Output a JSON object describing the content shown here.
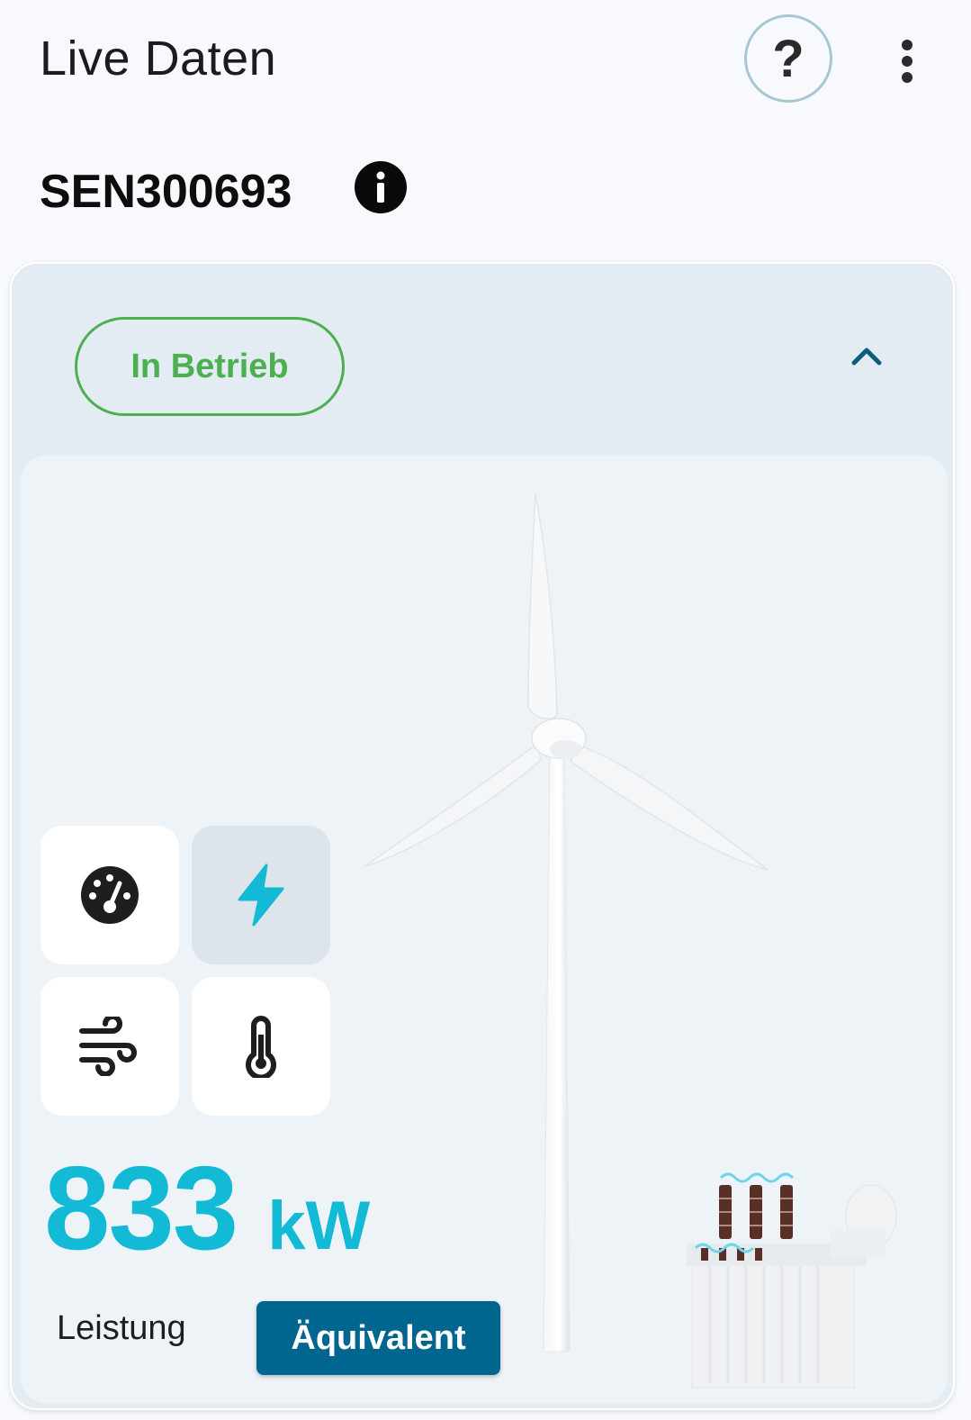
{
  "header": {
    "title": "Live Daten",
    "help_label": "?",
    "help_icon": "question-icon",
    "more_icon": "more-vert-icon"
  },
  "device": {
    "id": "SEN300693",
    "info_icon": "info-icon"
  },
  "status": {
    "label": "In Betrieb",
    "color": "#4caf50"
  },
  "metrics": {
    "tiles": [
      {
        "icon": "speedometer-icon",
        "active": false
      },
      {
        "icon": "lightning-bolt-icon",
        "active": true
      },
      {
        "icon": "wind-icon",
        "active": false
      },
      {
        "icon": "thermometer-icon",
        "active": false
      }
    ],
    "value": "833",
    "unit": "kW",
    "accent": "#12bad6"
  },
  "tabs": {
    "items": [
      "Leistung",
      "Äquivalent"
    ],
    "selected": "Äquivalent",
    "selected_color": "#006690"
  }
}
